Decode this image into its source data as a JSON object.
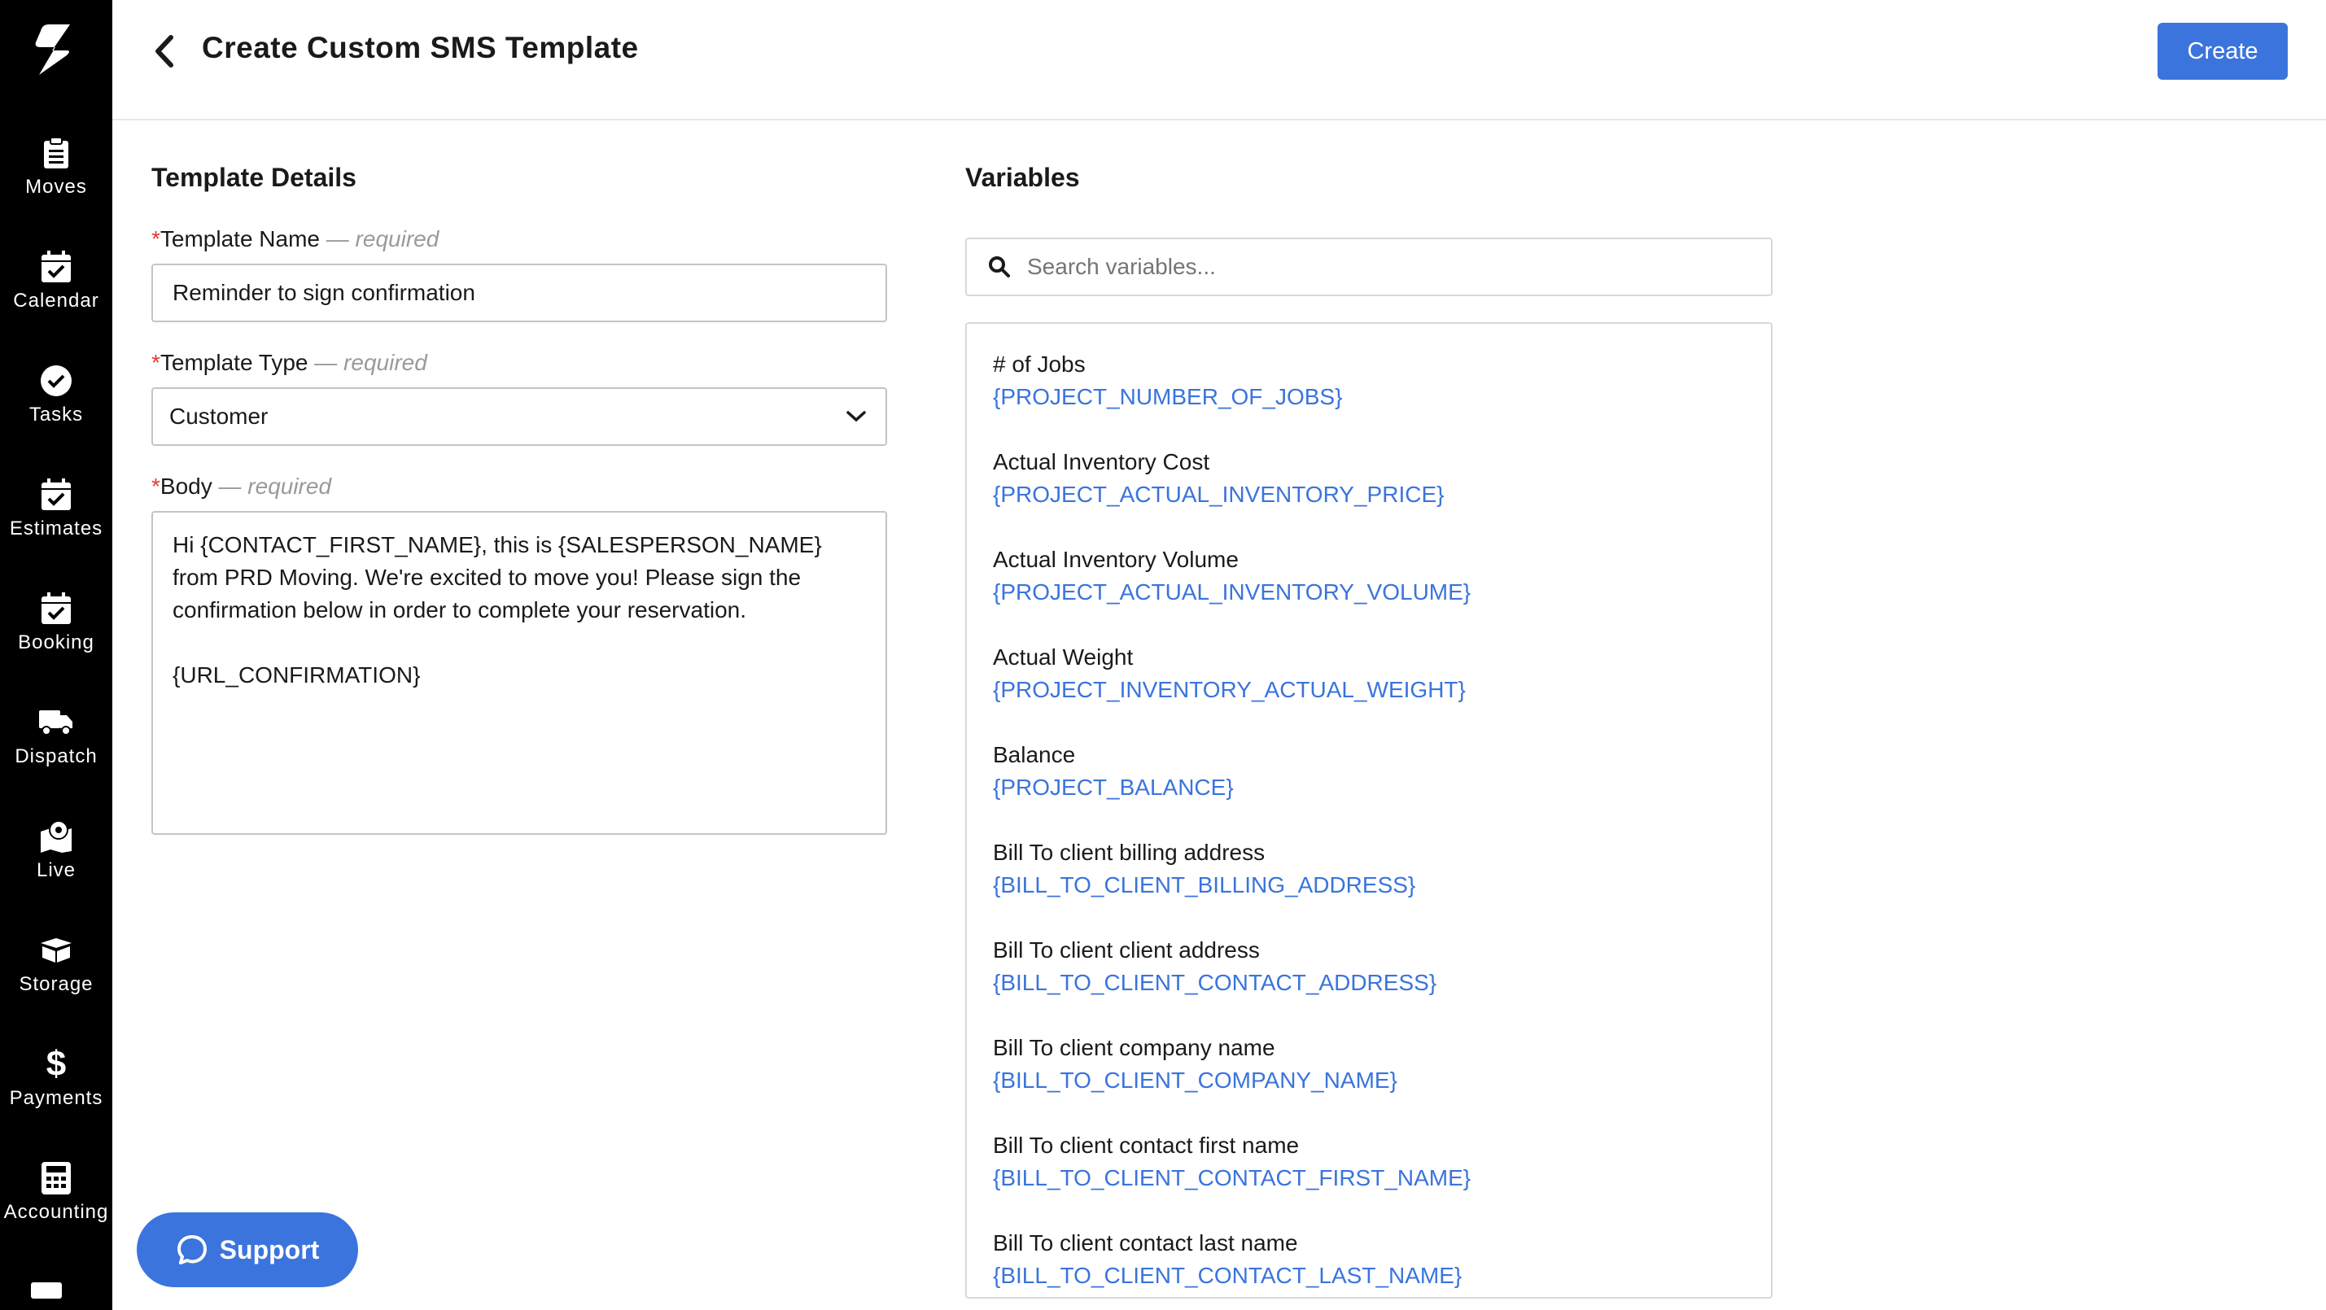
{
  "sidebar": {
    "items": [
      {
        "label": "Moves",
        "icon": "clipboard-icon"
      },
      {
        "label": "Calendar",
        "icon": "calendar-check-icon"
      },
      {
        "label": "Tasks",
        "icon": "check-circle-icon"
      },
      {
        "label": "Estimates",
        "icon": "calendar-check-icon"
      },
      {
        "label": "Booking",
        "icon": "calendar-check-icon"
      },
      {
        "label": "Dispatch",
        "icon": "truck-icon"
      },
      {
        "label": "Live",
        "icon": "map-pin-icon"
      },
      {
        "label": "Storage",
        "icon": "box-icon"
      },
      {
        "label": "Payments",
        "icon": "dollar-icon"
      },
      {
        "label": "Accounting",
        "icon": "calculator-icon"
      }
    ]
  },
  "header": {
    "title": "Create Custom SMS Template",
    "create_label": "Create"
  },
  "details": {
    "section_title": "Template Details",
    "name_label": "Template Name",
    "type_label": "Template Type",
    "body_label": "Body",
    "required_text": "— required",
    "required_star": "*",
    "name_value": "Reminder to sign confirmation",
    "type_value": "Customer",
    "body_value": "Hi {CONTACT_FIRST_NAME}, this is {SALESPERSON_NAME} from PRD Moving. We're excited to move you! Please sign the confirmation below in order to complete your reservation.\n\n{URL_CONFIRMATION}"
  },
  "variables": {
    "section_title": "Variables",
    "search_placeholder": "Search variables...",
    "items": [
      {
        "name": "# of Jobs",
        "key": "{PROJECT_NUMBER_OF_JOBS}"
      },
      {
        "name": "Actual Inventory Cost",
        "key": "{PROJECT_ACTUAL_INVENTORY_PRICE}"
      },
      {
        "name": "Actual Inventory Volume",
        "key": "{PROJECT_ACTUAL_INVENTORY_VOLUME}"
      },
      {
        "name": "Actual Weight",
        "key": "{PROJECT_INVENTORY_ACTUAL_WEIGHT}"
      },
      {
        "name": "Balance",
        "key": "{PROJECT_BALANCE}"
      },
      {
        "name": "Bill To client billing address",
        "key": "{BILL_TO_CLIENT_BILLING_ADDRESS}"
      },
      {
        "name": "Bill To client client address",
        "key": "{BILL_TO_CLIENT_CONTACT_ADDRESS}"
      },
      {
        "name": "Bill To client company name",
        "key": "{BILL_TO_CLIENT_COMPANY_NAME}"
      },
      {
        "name": "Bill To client contact first name",
        "key": "{BILL_TO_CLIENT_CONTACT_FIRST_NAME}"
      },
      {
        "name": "Bill To client contact last name",
        "key": "{BILL_TO_CLIENT_CONTACT_LAST_NAME}"
      }
    ]
  },
  "support": {
    "label": "Support"
  },
  "colors": {
    "accent": "#3c74dd",
    "link": "#3a74dc",
    "sidebar": "#000000",
    "required_star": "#e53935"
  }
}
